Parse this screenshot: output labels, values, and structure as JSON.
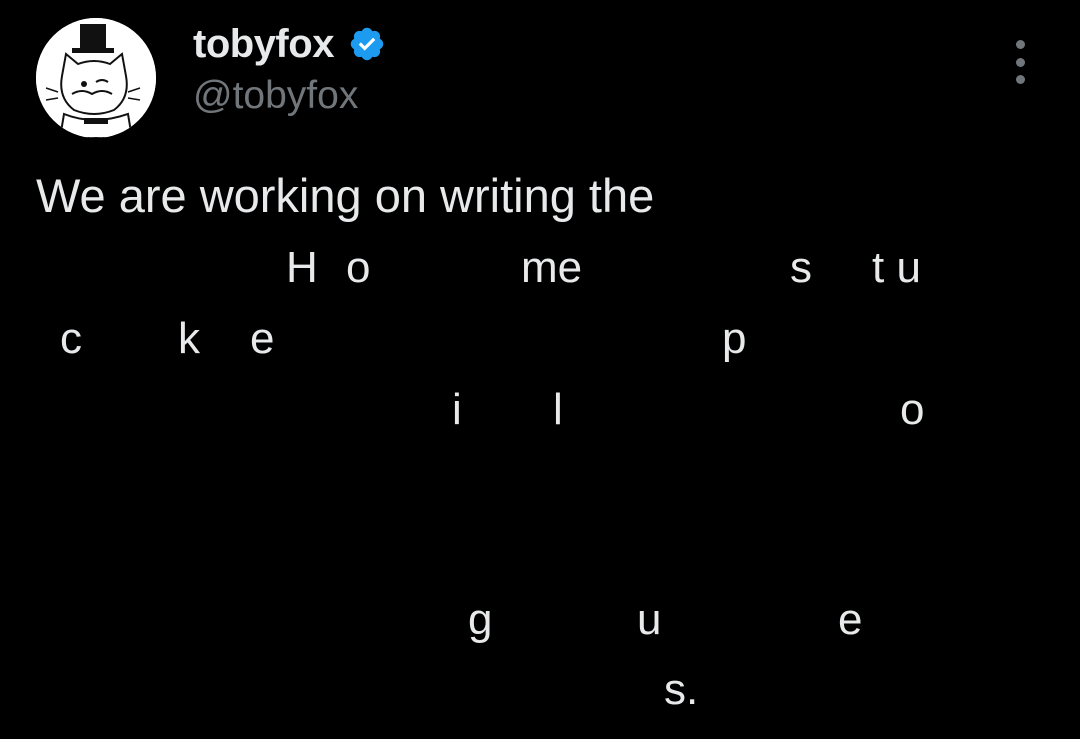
{
  "author": {
    "display_name": "tobyfox",
    "handle": "@tobyfox",
    "verified_color": "#1d9bf0",
    "verified_icon": "verified-badge-icon",
    "avatar_icon": "cat-with-top-hat-avatar"
  },
  "menu": {
    "more_icon": "more-vertical-icon"
  },
  "tweet": {
    "text": "We are working on writing the",
    "scattered": {
      "H": "H",
      "o1": "o",
      "me": "me",
      "s1": "s",
      "tu": "t u",
      "c": "c",
      "k": "k",
      "e1": "e",
      "p": "p",
      "i": "i",
      "l": "l",
      "o2": "o",
      "g": "g",
      "u": "u",
      "e2": "e",
      "s_end": "s."
    }
  },
  "colors": {
    "background": "#000000",
    "text": "#e7e9ea",
    "secondary": "#71767b"
  }
}
